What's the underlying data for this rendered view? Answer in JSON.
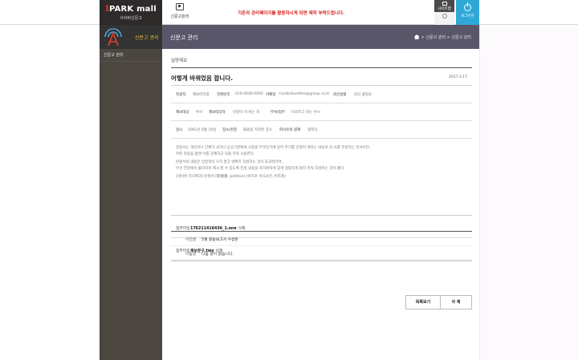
{
  "brand": {
    "logo": "PARK mall",
    "logo_i": "I",
    "sub": "사이버신문고"
  },
  "topnav": {
    "label": "신문고관리",
    "icon": "monitor-icon"
  },
  "notice": "기존의 관리페이지를 활용하시게 되면 재작 부탁드립니다.",
  "util": {
    "btn1": "사이트맵",
    "btn2": "",
    "logout": "로그아웃"
  },
  "sidebar": {
    "title": "신문고 관리",
    "items": [
      {
        "label": "신문고 관리"
      }
    ]
  },
  "header": {
    "title": "신문고 관리",
    "breadcrumb": "> 신문고 관리 > 신문고 관리"
  },
  "main": {
    "section_label": "실명제보",
    "post": {
      "title": "어렇게 바꿔었음 합니다.",
      "date": "2017.3.17",
      "meta1": [
        {
          "k": "작성자",
          "v": "해봐이리름"
        },
        {
          "k": "전화번호",
          "v": "010-0000-0000"
        },
        {
          "k": "이메일",
          "v": "hardtolevelthe@group.co.kr"
        },
        {
          "k": "회신방법",
          "v": "회신 불필요"
        }
      ],
      "meta2": [
        {
          "k": "제보대상",
          "v": "투브"
        },
        {
          "k": "제보대상자",
          "v": "비밀이 이 위는 자"
        },
        {
          "k": "부서/업무",
          "v": "브리이그 위는 투브"
        }
      ],
      "meta3": [
        {
          "k": "일시",
          "v": "1961년 8월 10일"
        },
        {
          "k": "장소/현장",
          "v": "불법을 저지른 장소"
        },
        {
          "k": "피사유의 원계",
          "v": "협력사"
        }
      ],
      "body": [
        "한동서는 게인이나 단체가 국가나 공공기관에게 사정을 무엇인가에 있어 주기를 간절히 바라는 내용의 의 사를 전달하는 문서이다.",
        "어떤 작동을 없앤 이를 강제하고 되돌 주로 사용한다.",
        "탄원서의 내용은 일방적이 으지 말고 명확히 작성하는 것이 효과적이며,",
        "우선 전달에서 불리하게 제시 할 수 있도록 진실 내용을 육하원칙에 맞게 걸림하게 않지 이워 작성하는 것이 좋다.",
        "[네이버 지식백과] 탄원서 [歎願書, petition] (버즈로 서식사전, 버즈폼)"
      ],
      "attachments": [
        {
          "k": "첨부파일",
          "file": "176211416436_1.one",
          "del": "삭제"
        },
        {
          "k": "첨부파일",
          "file": "제보문구.two",
          "del": "삭제"
        }
      ]
    },
    "nav": {
      "prev_label": "이전글",
      "prev_value": "5월 활동보고서 수정본",
      "next_label": "다음글",
      "next_value": "다음 글이 없습니다."
    },
    "buttons": {
      "list": "목록보기",
      "delete": "삭 제"
    }
  }
}
